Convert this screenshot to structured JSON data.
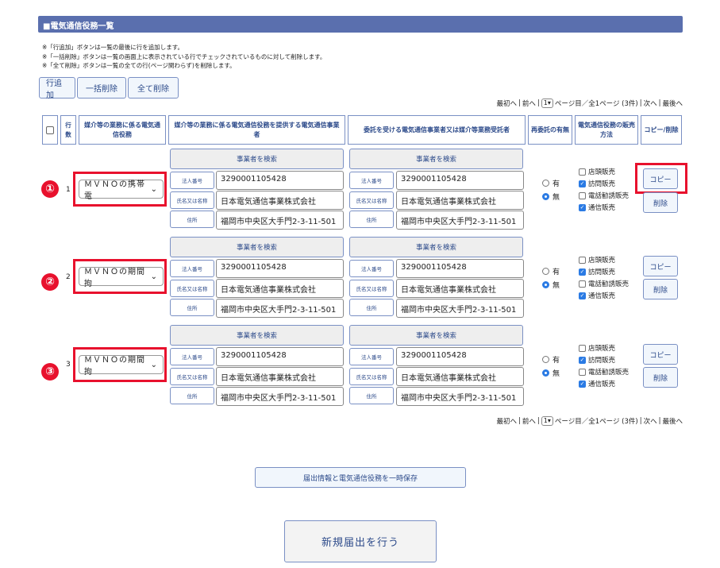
{
  "section_title": "■電気通信役務一覧",
  "notes": [
    "※「行追加」ボタンは一覧の最後に行を追加します。",
    "※「一括削除」ボタンは一覧の画面上に表示されている行でチェックされているものに対して削除します。",
    "※「全て削除」ボタンは一覧の全ての行(ページ関わらず)を削除します。"
  ],
  "toolbar": {
    "add_row": "行追加",
    "bulk_delete": "一括削除",
    "delete_all": "全て削除"
  },
  "pager": {
    "first": "最初へ",
    "prev": "前へ",
    "page_value": "1",
    "page_suffix": "ページ目／全1ページ (3件)",
    "next": "次へ",
    "last": "最後へ",
    "sep": "|"
  },
  "headers": {
    "num": "行数",
    "service": "媒介等の業務に係る電気通信役務",
    "provider": "媒介等の業務に係る電気通信役務を提供する電気通信事業者",
    "consignee": "委託を受ける電気通信事業者又は媒介等業務受託者",
    "reconsign": "再委託の有無",
    "method": "電気通信役務の販売方法",
    "copydel": "コピー/削除"
  },
  "common": {
    "search_label": "事業者を検索",
    "corp_no_label": "法人番号",
    "name_label": "氏名又は名称",
    "address_label": "住所",
    "radio_yes": "有",
    "radio_no": "無",
    "copy_label": "コピー",
    "delete_label": "削除",
    "methods": [
      "店頭販売",
      "訪問販売",
      "電話勧誘販売",
      "通信販売"
    ]
  },
  "rows": [
    {
      "marker": "①",
      "num": "1",
      "service": "ＭＶＮＯの携帯電",
      "provider": {
        "corp_no": "3290001105428",
        "name": "日本電気通信事業株式会社",
        "address": "福岡市中央区大手門2-3-11-501"
      },
      "consignee": {
        "corp_no": "3290001105428",
        "name": "日本電気通信事業株式会社",
        "address": "福岡市中央区大手門2-3-11-501"
      },
      "reconsign": "無",
      "methods_checked": [
        false,
        true,
        false,
        true
      ]
    },
    {
      "marker": "②",
      "num": "2",
      "service": "ＭＶＮＯの期間拘",
      "provider": {
        "corp_no": "3290001105428",
        "name": "日本電気通信事業株式会社",
        "address": "福岡市中央区大手門2-3-11-501"
      },
      "consignee": {
        "corp_no": "3290001105428",
        "name": "日本電気通信事業株式会社",
        "address": "福岡市中央区大手門2-3-11-501"
      },
      "reconsign": "無",
      "methods_checked": [
        false,
        true,
        false,
        true
      ]
    },
    {
      "marker": "③",
      "num": "3",
      "service": "ＭＶＮＯの期間拘",
      "provider": {
        "corp_no": "3290001105428",
        "name": "日本電気通信事業株式会社",
        "address": "福岡市中央区大手門2-3-11-501"
      },
      "consignee": {
        "corp_no": "3290001105428",
        "name": "日本電気通信事業株式会社",
        "address": "福岡市中央区大手門2-3-11-501"
      },
      "reconsign": "無",
      "methods_checked": [
        false,
        true,
        false,
        true
      ]
    }
  ],
  "save_button": "届出情報と電気通信役務を一時保存",
  "submit_button": "新規届出を行う",
  "colors": {
    "header_bg": "#5a6fae",
    "accent": "#2c4a8a",
    "highlight": "#e8112d",
    "check": "#2b7be4"
  }
}
